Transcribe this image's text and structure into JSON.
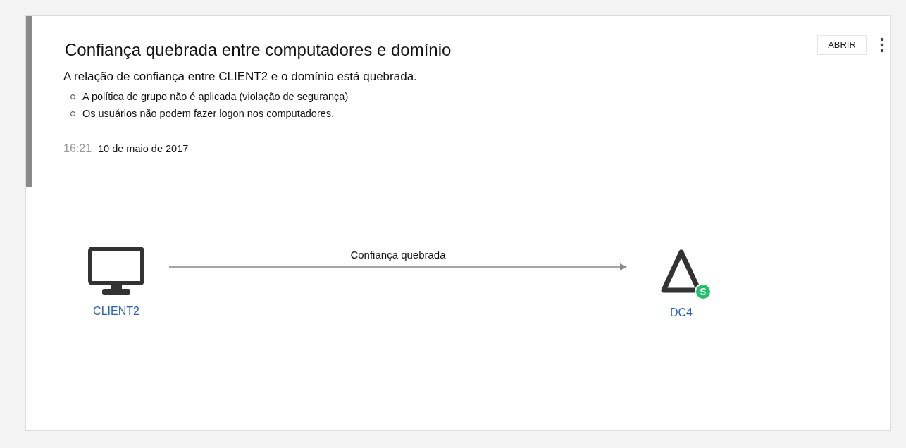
{
  "alert": {
    "title": "Confiança quebrada entre computadores e domínio",
    "summary": "A relação de confiança entre CLIENT2 e o domínio está quebrada.",
    "details": [
      "A política de grupo não é aplicada (violação de segurança)",
      "Os usuários não podem fazer logon nos computadores."
    ],
    "time": "16:21",
    "date": "10 de maio de 2017",
    "open_button": "ABRIR"
  },
  "diagram": {
    "source": {
      "label": "CLIENT2"
    },
    "connection": {
      "label": "Confiança quebrada"
    },
    "target": {
      "label": "DC4",
      "badge": "S"
    }
  }
}
